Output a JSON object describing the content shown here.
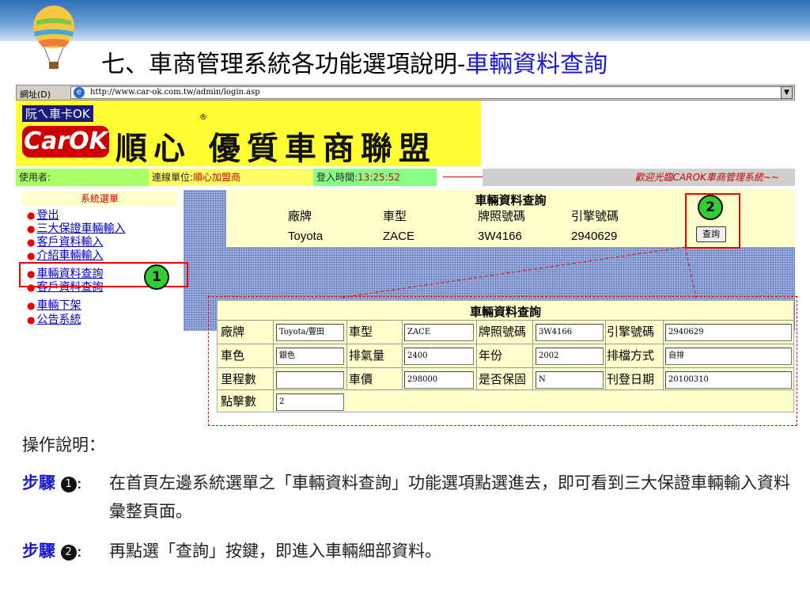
{
  "slide": {
    "title_prefix": "七、車商管理系統各功能選項說明-",
    "title_highlight": "車輛資料查詢"
  },
  "browser": {
    "address_label": "網址(D)",
    "url": "http://www.car-ok.com.tw/admin/login.asp"
  },
  "banner": {
    "small_logo": "阮ㄟ車卡OK",
    "carok_logo": "CarOK",
    "brand": "順心 優質車商聯盟",
    "registered": "®"
  },
  "status": {
    "user_label": "使用者:",
    "unit_label": "連線單位:",
    "unit_value": "順心加盟商",
    "login_label": "登入時間:",
    "login_value": "13:25:52",
    "welcome": "歡迎光臨CAROK車商管理系統~~"
  },
  "sidebar": {
    "header": "系統選單",
    "items": [
      "登出",
      "三大保證車輛輸入",
      "客戶資料輸入",
      "介紹車輛輸入",
      "車輛資料查詢",
      "客戶資料查詢",
      "車輛下架",
      "公告系統"
    ]
  },
  "query": {
    "title": "車輛資料查詢",
    "columns": [
      "廠牌",
      "車型",
      "牌照號碼",
      "引擎號碼"
    ],
    "row": [
      "Toyota",
      "ZACE",
      "3W4166",
      "2940629"
    ],
    "button": "查詢"
  },
  "detail": {
    "title": "車輛資料查詢",
    "rows": [
      [
        {
          "label": "廠牌",
          "value": "Toyota/豐田"
        },
        {
          "label": "車型",
          "value": "ZACE"
        },
        {
          "label": "牌照號碼",
          "value": "3W4166"
        },
        {
          "label": "引擎號碼",
          "value": "2940629"
        }
      ],
      [
        {
          "label": "車色",
          "value": "銀色"
        },
        {
          "label": "排氣量",
          "value": "2400"
        },
        {
          "label": "年份",
          "value": "2002"
        },
        {
          "label": "排檔方式",
          "value": "自排"
        }
      ],
      [
        {
          "label": "里程數",
          "value": ""
        },
        {
          "label": "車價",
          "value": "298000"
        },
        {
          "label": "是否保固",
          "value": "N"
        },
        {
          "label": "刊登日期",
          "value": "20100310"
        }
      ],
      [
        {
          "label": "點擊數",
          "value": "2"
        }
      ]
    ]
  },
  "callouts": {
    "one": "1",
    "two": "2"
  },
  "instructions": {
    "heading": "操作說明：",
    "step_label": "步驟",
    "step1_num": "1",
    "step1_text": "在首頁左邊系統選單之「車輛資料查詢」功能選項點選進去，即可看到三大保證車輛輸入資料彙整頁面。",
    "step2_num": "2",
    "step2_text": "再點選「查詢」按鍵，即進入車輛細部資料。"
  },
  "colors": {
    "accent": "#1a1ad0",
    "callout": "#e00000",
    "badge": "#33cc33",
    "panel": "#ffffcc"
  }
}
